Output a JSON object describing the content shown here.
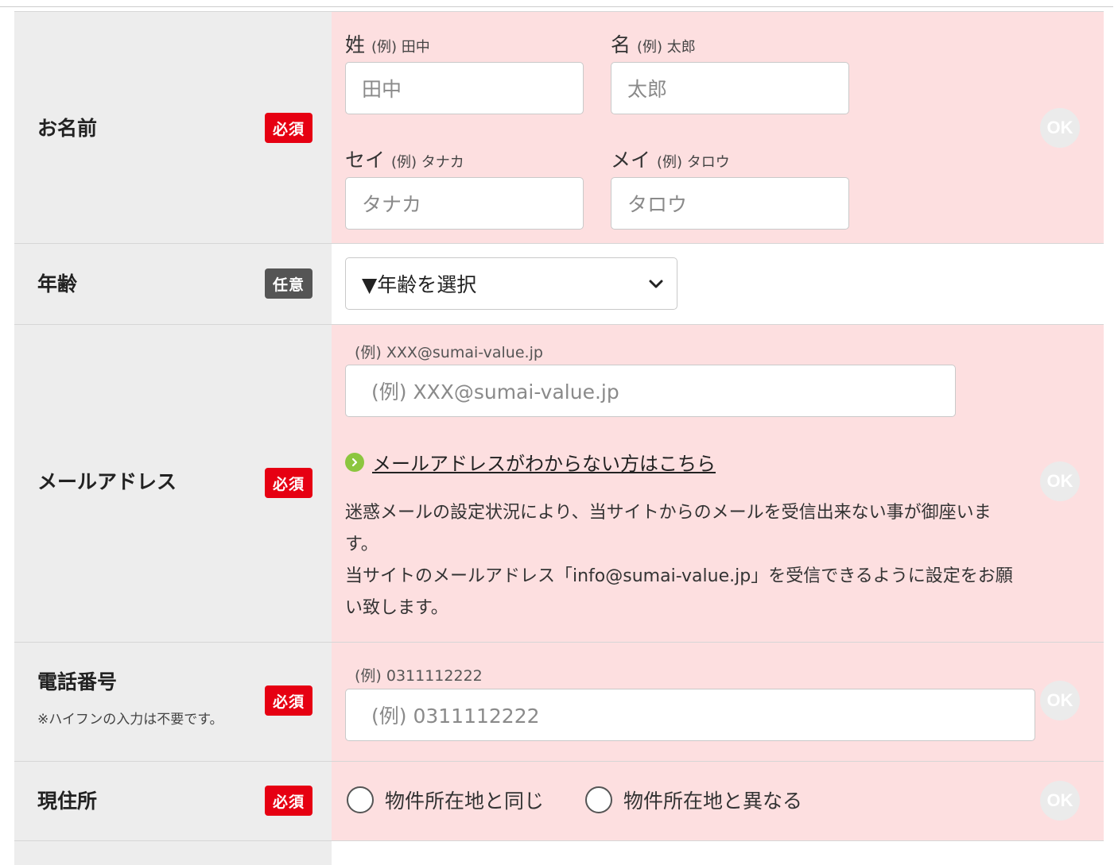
{
  "form": {
    "badge_required": "必須",
    "badge_optional": "任意",
    "ok_label": "OK",
    "name": {
      "label": "お名前",
      "last": {
        "label": "姓",
        "example": "(例) 田中",
        "placeholder": "田中"
      },
      "first": {
        "label": "名",
        "example": "(例) 太郎",
        "placeholder": "太郎"
      },
      "last_kana": {
        "label": "セイ",
        "example": "(例) タナカ",
        "placeholder": "タナカ"
      },
      "first_kana": {
        "label": "メイ",
        "example": "(例) タロウ",
        "placeholder": "タロウ"
      }
    },
    "age": {
      "label": "年齢",
      "selected": "▼年齢を選択"
    },
    "email": {
      "label": "メールアドレス",
      "example": "(例) XXX@sumai-value.jp",
      "placeholder": "(例) XXX@sumai-value.jp",
      "help_link": "メールアドレスがわからない方はこちら",
      "note_line1": "迷惑メールの設定状況により、当サイトからのメールを受信出来ない事が御座いま",
      "note_line2": "す。",
      "note_line3": "当サイトのメールアドレス「info@sumai-value.jp」を受信できるように設定をお願",
      "note_line4": "い致します。"
    },
    "phone": {
      "label": "電話番号",
      "note": "※ハイフンの入力は不要です。",
      "example": "(例) 0311112222",
      "placeholder": "(例) 0311112222"
    },
    "address": {
      "label": "現住所",
      "option_same": "物件所在地と同じ",
      "option_diff": "物件所在地と異なる"
    }
  },
  "colors": {
    "required_badge": "#e60012",
    "optional_badge": "#555555",
    "field_bg_pending": "#fddfe0",
    "link_icon": "#8cc63f"
  }
}
